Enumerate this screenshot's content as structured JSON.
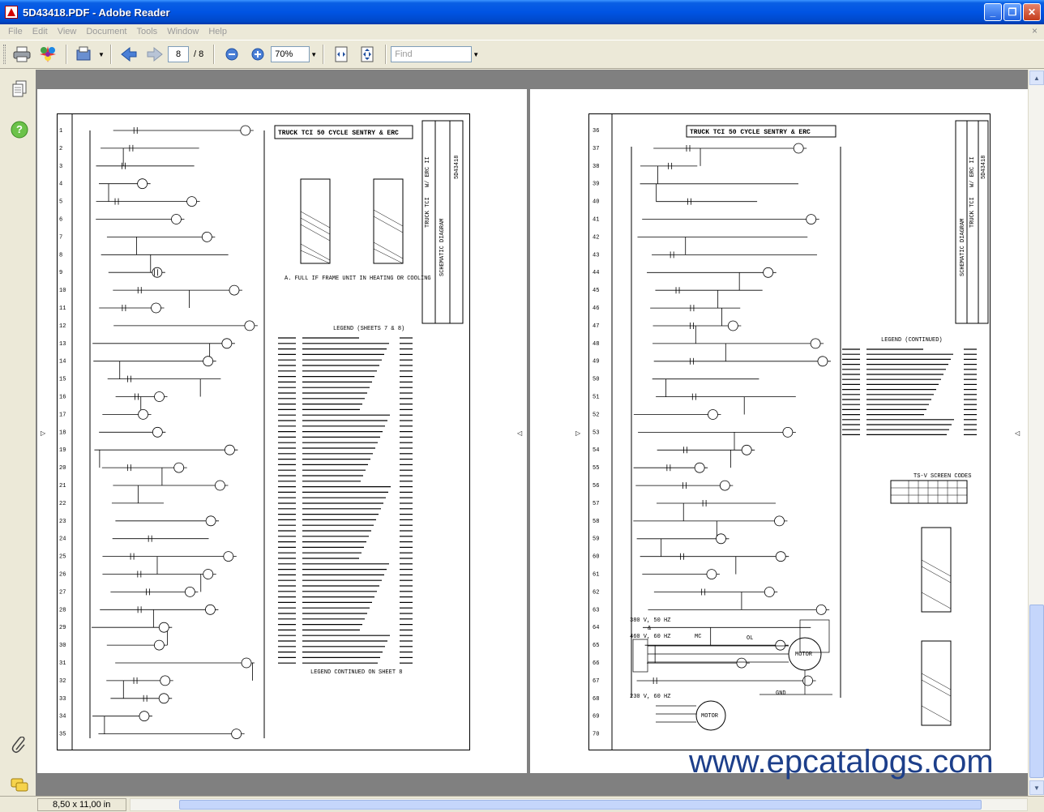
{
  "window": {
    "title": "5D43418.PDF - Adobe Reader",
    "buttons": {
      "minimize": "_",
      "restore": "❐",
      "close": "✕"
    }
  },
  "menu": {
    "items": [
      "File",
      "Edit",
      "View",
      "Document",
      "Tools",
      "Window",
      "Help"
    ],
    "close": "×"
  },
  "toolbar": {
    "current_page": "8",
    "page_of": "/ 8",
    "zoom": "70%",
    "find_placeholder": "Find"
  },
  "status": {
    "page_size": "8,50 x 11,00 in"
  },
  "schematic_left": {
    "title": "TRUCK TCI 50 CYCLE SENTRY & ERC",
    "row_numbers": [
      "1",
      "2",
      "3",
      "4",
      "5",
      "6",
      "7",
      "8",
      "9",
      "10",
      "11",
      "12",
      "13",
      "14",
      "15",
      "16",
      "17",
      "18",
      "19",
      "20",
      "21",
      "22",
      "23",
      "24",
      "25",
      "26",
      "27",
      "28",
      "29",
      "30",
      "31",
      "32",
      "33",
      "34",
      "35"
    ],
    "side_labels": [
      "SCHEMATIC DIAGRAM",
      "TRUCK TCI",
      "W/ ERC II",
      "5D43418"
    ],
    "note": "A. FULL IF FRAME UNIT IN HEATING OR COOLING",
    "legend_title": "LEGEND (SHEETS 7 & 8)",
    "legend_continued": "LEGEND CONTINUED ON SHEET 8"
  },
  "schematic_right": {
    "title": "TRUCK TCI 50 CYCLE SENTRY & ERC",
    "row_numbers": [
      "36",
      "37",
      "38",
      "39",
      "40",
      "41",
      "42",
      "43",
      "44",
      "45",
      "46",
      "47",
      "48",
      "49",
      "50",
      "51",
      "52",
      "53",
      "54",
      "55",
      "56",
      "57",
      "58",
      "59",
      "60",
      "61",
      "62",
      "63",
      "64",
      "65",
      "66",
      "67",
      "68",
      "69",
      "70"
    ],
    "side_labels": [
      "SCHEMATIC DIAGRAM",
      "TRUCK TCI",
      "W/ ERC II",
      "5D43418"
    ],
    "legend_title": "LEGEND (CONTINUED)",
    "ts_table_title": "TS-V SCREEN CODES",
    "power_labels": [
      "380 V, 50 HZ",
      "&",
      "460 V, 60 HZ",
      "230 V, 60 HZ",
      "MC",
      "OL",
      "MOTOR",
      "GND",
      "CH"
    ]
  },
  "watermark": "www.epcatalogs.com",
  "icons": {
    "print": "printer-icon",
    "organizer": "organizer-icon",
    "review": "review-icon",
    "prev": "previous-page-icon",
    "next": "next-page-icon",
    "zoom_out": "zoom-out-icon",
    "zoom_in": "zoom-in-icon",
    "fit_page": "fit-page-icon",
    "fit_width": "fit-width-icon"
  }
}
